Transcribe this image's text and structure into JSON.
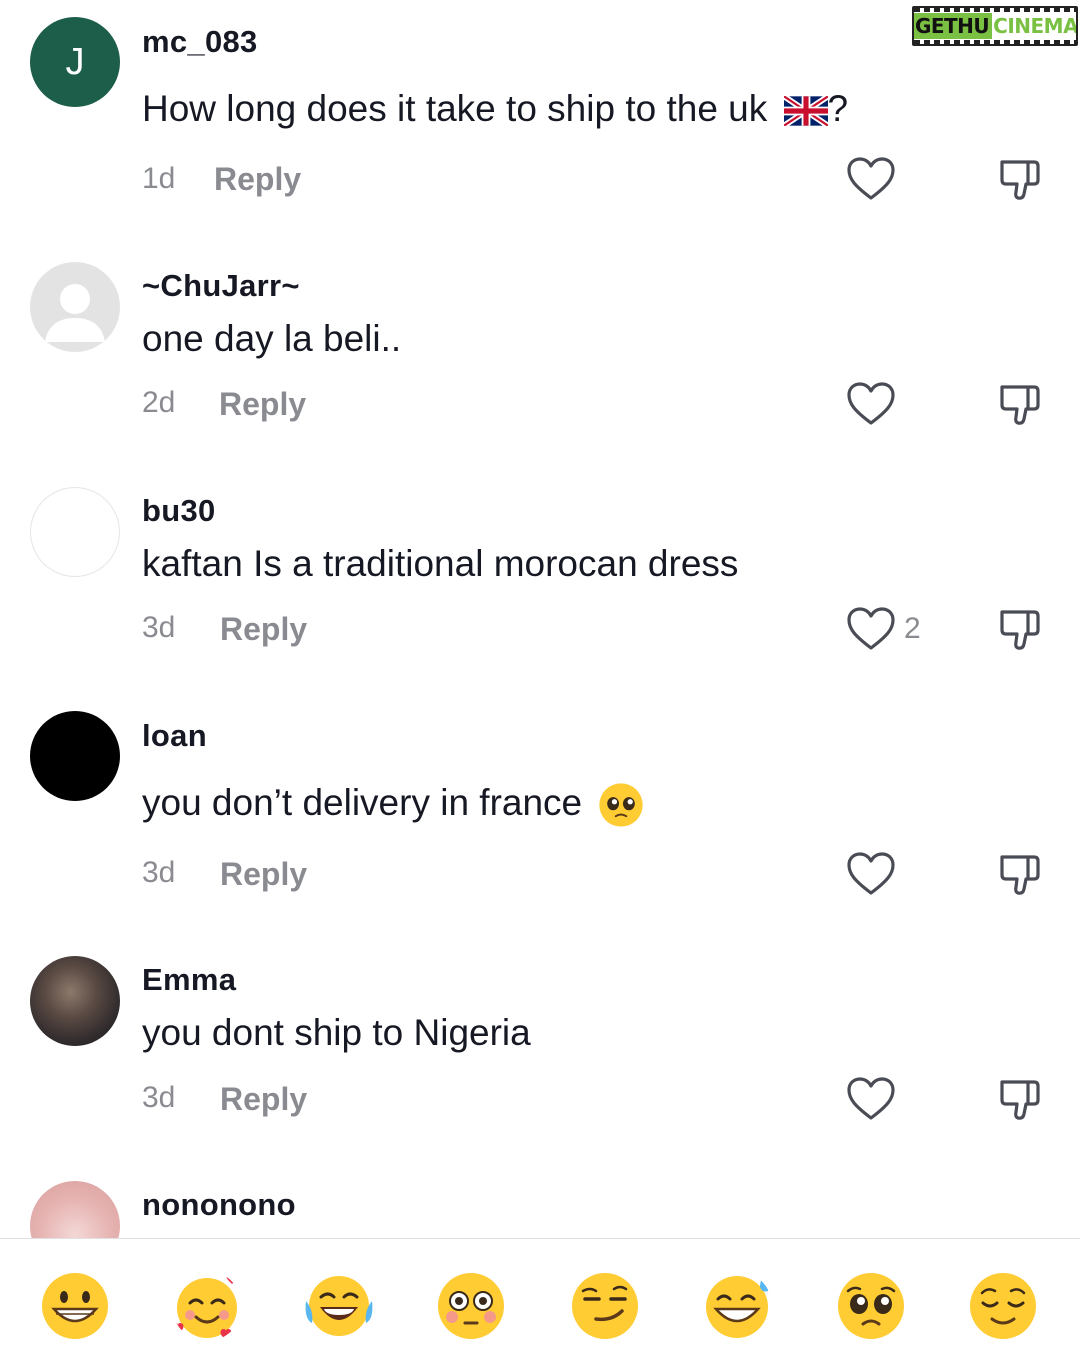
{
  "watermark": {
    "part1": "GETHU",
    "part2": "CINEMA"
  },
  "comments": [
    {
      "avatar_letter": "J",
      "username": "mc_083",
      "text": "How long does it take to ship to the uk",
      "text_emoji": "uk-flag",
      "age": "1d",
      "reply": "Reply",
      "likes": ""
    },
    {
      "avatar_letter": "",
      "username": "~ChuJarr~",
      "text": "one day la beli..",
      "age": "2d",
      "reply": "Reply",
      "likes": ""
    },
    {
      "avatar_letter": "",
      "username": "bu30",
      "text": "kaftan Is a traditional morocan dress",
      "age": "3d",
      "reply": "Reply",
      "likes": "2"
    },
    {
      "avatar_letter": "",
      "username": "loan",
      "text": "you don’t delivery in france",
      "text_emoji": "pleading-face",
      "age": "3d",
      "reply": "Reply",
      "likes": ""
    },
    {
      "avatar_letter": "",
      "username": "Emma",
      "text": "you dont ship to Nigeria",
      "age": "3d",
      "reply": "Reply",
      "likes": ""
    },
    {
      "avatar_letter": "",
      "username": "nononono"
    }
  ],
  "first_comment_suffix": "?",
  "emoji_bar": [
    "grinning-face",
    "smiling-face-with-hearts",
    "face-with-tears-of-joy",
    "flushed-face",
    "smirking-face",
    "grinning-face-with-sweat",
    "pleading-face",
    "relieved-face"
  ],
  "colors": {
    "primary_text": "#161823",
    "secondary_text": "#8a8b91",
    "avatar_letter_bg": "#1d5e4a",
    "watermark_green": "#7ac143"
  }
}
